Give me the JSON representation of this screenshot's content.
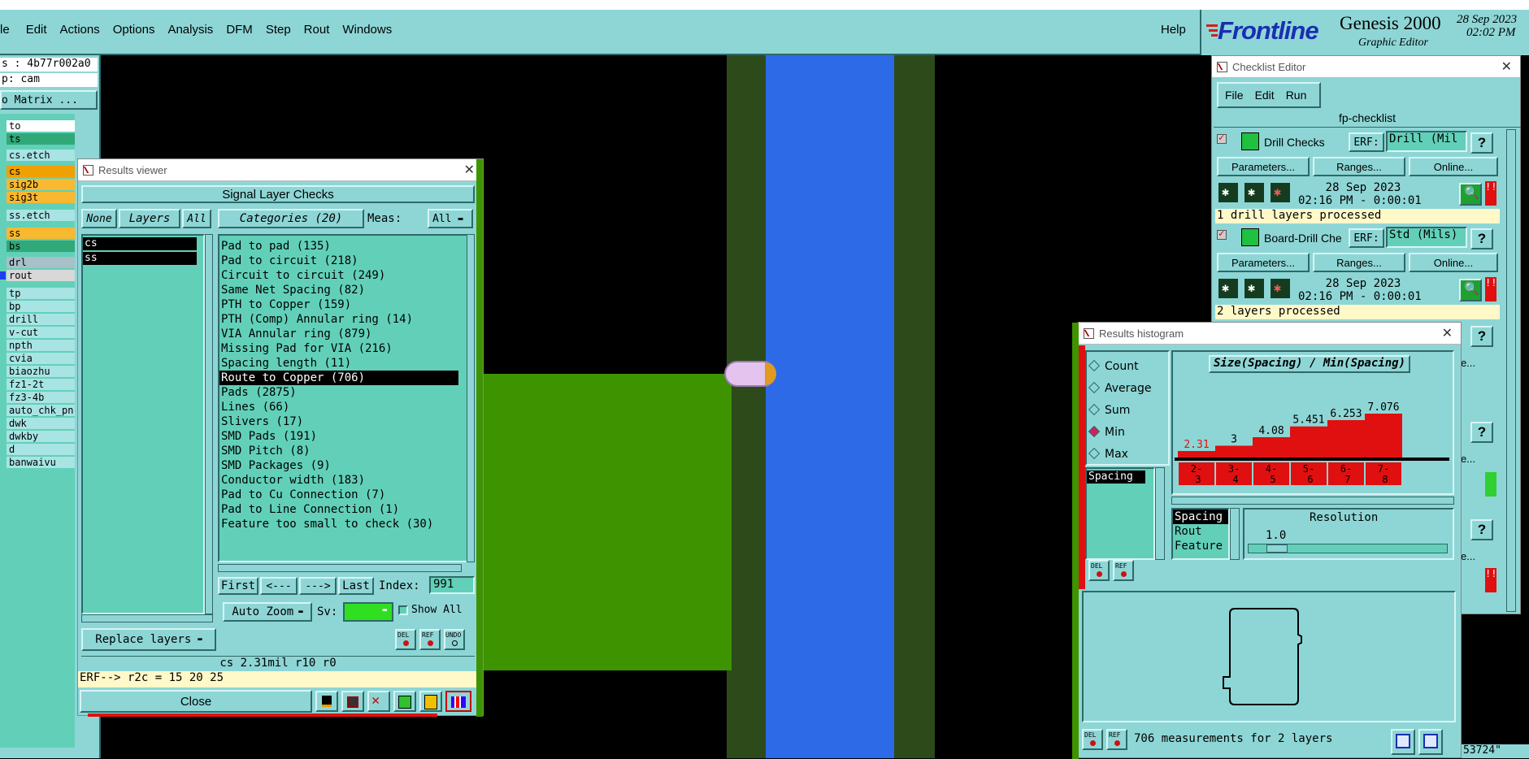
{
  "menubar": {
    "items": [
      "le",
      "Edit",
      "Actions",
      "Options",
      "Analysis",
      "DFM",
      "Step",
      "Rout",
      "Windows"
    ],
    "help": "Help"
  },
  "brand": {
    "logo": "Frontline",
    "product": "Genesis 2000",
    "subtitle": "Graphic Editor",
    "date": "28 Sep 2023",
    "time": "02:02 PM"
  },
  "left_panel": {
    "job": "s : 4b77r002a0",
    "step": "p: cam",
    "matrix_btn": "o Matrix ...",
    "layers": [
      "to",
      "ts",
      "cs.etch",
      "cs",
      "sig2b",
      "sig3t",
      "ss.etch",
      "ss",
      "bs",
      "drl",
      "rout",
      "tp",
      "bp",
      "drill",
      "v-cut",
      "npth",
      "cvia",
      "biaozhu",
      "fz1-2t",
      "fz3-4b",
      "auto_chk_pn.",
      "dwk",
      "dwkby",
      "d",
      "banwaivu"
    ]
  },
  "results_viewer": {
    "title": "Results viewer",
    "header": "Signal Layer Checks",
    "none_btn": "None",
    "layers_btn": "Layers",
    "all_btn": "All",
    "categories_btn": "Categories (20)",
    "meas_label": "Meas:",
    "meas_value": "All",
    "layer_list": [
      "cs",
      "ss"
    ],
    "categories": [
      "Pad to pad (135)",
      "Pad to circuit (218)",
      "Circuit to circuit (249)",
      "Same Net Spacing (82)",
      "PTH to Copper (159)",
      "PTH (Comp) Annular ring (14)",
      "VIA Annular ring (879)",
      "Missing Pad for VIA (216)",
      "Spacing length (11)",
      "Route to Copper (706)",
      "Pads (2875)",
      "Lines (66)",
      "Slivers (17)",
      "SMD Pads (191)",
      "SMD Pitch (8)",
      "SMD Packages (9)",
      "Conductor width (183)",
      "Pad to Cu Connection (7)",
      "Pad to Line Connection (1)",
      "Feature too small to check (30)"
    ],
    "selected_index": 9,
    "first_btn": "First",
    "prev_btn": "<---",
    "next_btn": "--->",
    "last_btn": "Last",
    "index_label": "Index:",
    "index_value": "991",
    "auto_zoom": "Auto Zoom",
    "sv_label": "Sv:",
    "show_all": "Show All",
    "replace_layers": "Replace layers",
    "del": "DEL",
    "ref": "REF",
    "undo": "UNDO",
    "status": "cs 2.31mil  r10  r0",
    "erf": "ERF--> r2c = 15 20 25",
    "close_btn": "Close"
  },
  "checklist_editor": {
    "title": "Checklist Editor",
    "menu": [
      "File",
      "Edit",
      "Run"
    ],
    "checklist_name": "fp-checklist",
    "checks": [
      {
        "name": "Drill Checks",
        "erf_label": "ERF:",
        "erf": "Drill (Mil",
        "date": "28 Sep 2023",
        "time": "02:16 PM - 0:00:01",
        "status": "1 drill layers processed"
      },
      {
        "name": "Board-Drill Che",
        "erf_label": "ERF:",
        "erf": "Std (Mils)",
        "date": "28 Sep 2023",
        "time": "02:16 PM - 0:00:01",
        "status": "2 layers processed"
      }
    ],
    "parameters_btn": "Parameters...",
    "ranges_btn": "Ranges...",
    "online_btn": "Online...",
    "help_btn": "?",
    "partial_btn": "e..."
  },
  "histogram": {
    "title": "Results histogram",
    "options": [
      "Count",
      "Average",
      "Sum",
      "Min",
      "Max"
    ],
    "selected_option": "Min",
    "chart_title": "Size(Spacing) / Min(Spacing)",
    "list_items": [
      "Spacing"
    ],
    "bars": [
      {
        "range": "2-3",
        "range_a": "2-",
        "range_b": "3",
        "value": 2.31,
        "label": "2.31",
        "highlight": true
      },
      {
        "range": "3-4",
        "range_a": "3-",
        "range_b": "4",
        "value": 3,
        "label": "3",
        "highlight": false
      },
      {
        "range": "4-5",
        "range_a": "4-",
        "range_b": "5",
        "value": 4.08,
        "label": "4.08",
        "highlight": false
      },
      {
        "range": "5-6",
        "range_a": "5-",
        "range_b": "6",
        "value": 5.451,
        "label": "5.451",
        "highlight": false
      },
      {
        "range": "6-7",
        "range_a": "6-",
        "range_b": "7",
        "value": 6.253,
        "label": "6.253",
        "highlight": false
      },
      {
        "range": "7-8",
        "range_a": "7-",
        "range_b": "8",
        "value": 7.076,
        "label": "7.076",
        "highlight": false
      }
    ],
    "value_max": 7.076,
    "bar_color": "#e01010",
    "measure_list": [
      "Spacing",
      "Rout",
      "Feature"
    ],
    "resolution_label": "Resolution",
    "resolution_value": "1.0",
    "status": "706 measurements for 2 layers",
    "del": "DEL",
    "ref": "REF"
  },
  "corner_readout": "53724\"",
  "colors": {
    "panel": "#8ed6d6",
    "list_bg": "#62d0b8",
    "copper_green": "#3e9300",
    "dark_green": "#2c4a1a",
    "rout_blue": "#2c6ae8",
    "selection": "#000000"
  }
}
